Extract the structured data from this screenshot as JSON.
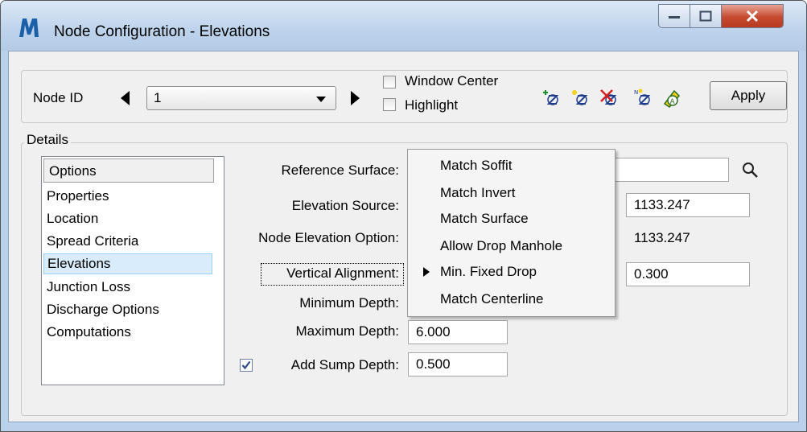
{
  "window": {
    "title": "Node Configuration - Elevations",
    "app_icon": "bentley-icon"
  },
  "toolbar": {
    "node_id_label": "Node ID",
    "node_id_value": "1",
    "window_center_label": "Window Center",
    "window_center_checked": false,
    "highlight_label": "Highlight",
    "highlight_checked": false,
    "tools": [
      "add-node-icon",
      "place-node-icon",
      "delete-node-icon",
      "edit-node-icon",
      "node-report-icon"
    ],
    "apply_label": "Apply"
  },
  "details": {
    "group_label": "Details",
    "list_header": "Options",
    "items": [
      "Properties",
      "Location",
      "Spread Criteria",
      "Elevations",
      "Junction Loss",
      "Discharge Options",
      "Computations"
    ],
    "selected_item": "Elevations"
  },
  "form": {
    "reference_surface_label": "Reference Surface:",
    "reference_surface_value": "",
    "elevation_source_label": "Elevation Source:",
    "elevation_source_value": "1133.247",
    "node_elevation_option_label": "Node Elevation Option:",
    "node_elevation_option_value": "1133.247",
    "vertical_alignment_label": "Vertical Alignment:",
    "vertical_alignment_value": "0.300",
    "minimum_depth_label": "Minimum Depth:",
    "maximum_depth_label": "Maximum Depth:",
    "maximum_depth_value": "6.000",
    "add_sump_depth_label": "Add Sump Depth:",
    "add_sump_depth_checked": true,
    "add_sump_depth_value": "0.500"
  },
  "dropdown": {
    "options": [
      "Match Soffit",
      "Match Invert",
      "Match Surface",
      "Allow Drop Manhole",
      "Min. Fixed Drop",
      "Match Centerline"
    ],
    "selected": "Min. Fixed Drop"
  },
  "colors": {
    "title_bar": "#bdd3ec",
    "close_button": "#c44a30",
    "selection": "#d9ecfb"
  }
}
